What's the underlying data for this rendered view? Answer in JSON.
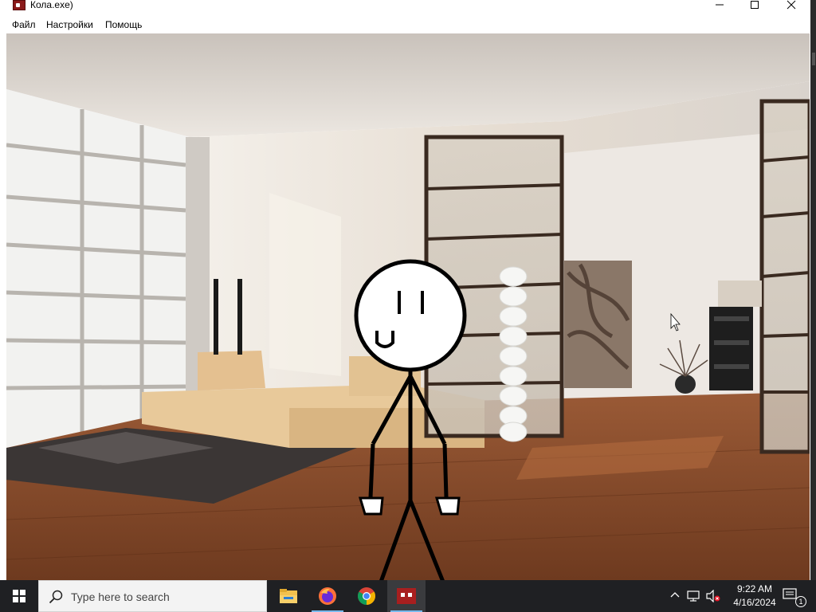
{
  "window": {
    "title": "Кола.exe)",
    "menu": {
      "file": "Файл",
      "settings": "Настройки",
      "help": "Помощь"
    }
  },
  "taskbar": {
    "search_placeholder": "Type here to search",
    "apps": [
      "file-explorer",
      "firefox",
      "chrome",
      "kola-exe"
    ],
    "active_app": "kola-exe"
  },
  "tray": {
    "time": "9:22 AM",
    "date": "4/16/2024",
    "notification_count": "1"
  },
  "colors": {
    "taskbar": "#1f2023",
    "app_icon": "#8b1a1a",
    "floor": "#8a4a2a",
    "wall": "#e9e3dc"
  }
}
